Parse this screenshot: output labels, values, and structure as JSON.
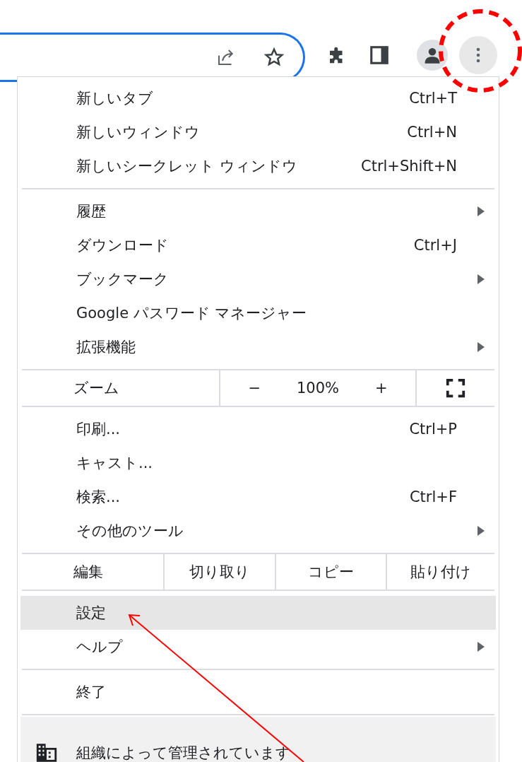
{
  "menu": {
    "rows": [
      {
        "kind": "item",
        "label": "新しいタブ",
        "shortcut": "Ctrl+T",
        "submenu": false,
        "selected": false
      },
      {
        "kind": "item",
        "label": "新しいウィンドウ",
        "shortcut": "Ctrl+N",
        "submenu": false,
        "selected": false
      },
      {
        "kind": "item",
        "label": "新しいシークレット ウィンドウ",
        "shortcut": "Ctrl+Shift+N",
        "submenu": false,
        "selected": false
      },
      {
        "kind": "separator"
      },
      {
        "kind": "item",
        "label": "履歴",
        "submenu": true,
        "selected": false
      },
      {
        "kind": "item",
        "label": "ダウンロード",
        "shortcut": "Ctrl+J",
        "submenu": false,
        "selected": false
      },
      {
        "kind": "item",
        "label": "ブックマーク",
        "submenu": true,
        "selected": false
      },
      {
        "kind": "item",
        "label": "Google パスワード マネージャー",
        "submenu": false,
        "selected": false
      },
      {
        "kind": "item",
        "label": "拡張機能",
        "submenu": true,
        "selected": false
      },
      {
        "kind": "separator"
      },
      {
        "kind": "zoom",
        "label": "ズーム",
        "minus": "−",
        "value": "100%",
        "plus": "+"
      },
      {
        "kind": "separator"
      },
      {
        "kind": "item",
        "label": "印刷...",
        "shortcut": "Ctrl+P",
        "submenu": false,
        "selected": false
      },
      {
        "kind": "item",
        "label": "キャスト...",
        "submenu": false,
        "selected": false
      },
      {
        "kind": "item",
        "label": "検索...",
        "shortcut": "Ctrl+F",
        "submenu": false,
        "selected": false
      },
      {
        "kind": "item",
        "label": "その他のツール",
        "submenu": true,
        "selected": false
      },
      {
        "kind": "separator"
      },
      {
        "kind": "edit",
        "label": "編集",
        "actions": [
          "切り取り",
          "コピー",
          "貼り付け"
        ]
      },
      {
        "kind": "separator"
      },
      {
        "kind": "item",
        "label": "設定",
        "submenu": false,
        "selected": true
      },
      {
        "kind": "item",
        "label": "ヘルプ",
        "submenu": true,
        "selected": false
      },
      {
        "kind": "separator"
      },
      {
        "kind": "item",
        "label": "終了",
        "submenu": false,
        "selected": false
      },
      {
        "kind": "separator"
      },
      {
        "kind": "managed",
        "label": "組織によって管理されています"
      }
    ]
  }
}
